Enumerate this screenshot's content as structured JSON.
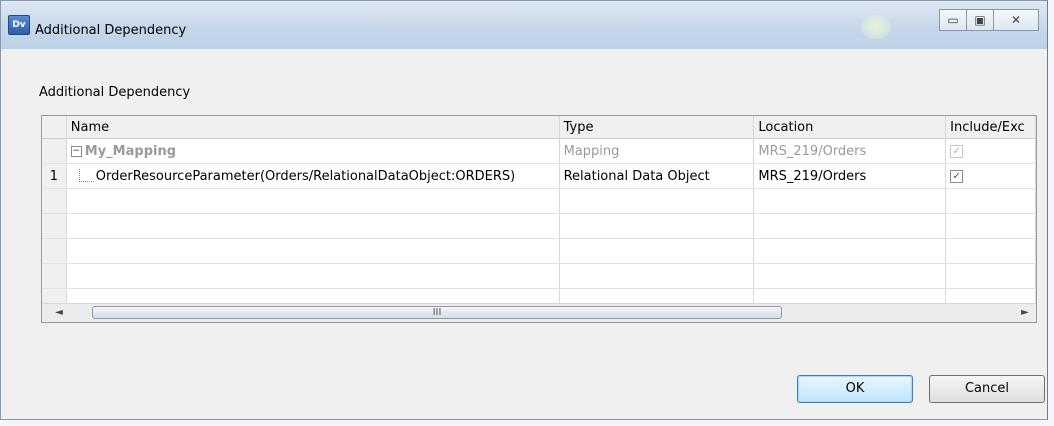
{
  "window": {
    "title": "Additional Dependency",
    "app_icon_text": "Dv",
    "controls": {
      "minimize": "▭",
      "maximize": "▣",
      "close": "✕"
    }
  },
  "section_label": "Additional Dependency",
  "grid": {
    "columns": [
      "Name",
      "Type",
      "Location",
      "Include/Exc"
    ],
    "rows": [
      {
        "num": "",
        "name": "My_Mapping",
        "type": "Mapping",
        "location": "MRS_219/Orders",
        "checked": true,
        "enabled": false,
        "kind": "parent"
      },
      {
        "num": "1",
        "name": "OrderResourceParameter(Orders/RelationalDataObject:ORDERS)",
        "type": "Relational Data Object",
        "location": "MRS_219/Orders",
        "checked": true,
        "enabled": true,
        "kind": "child"
      }
    ],
    "scroll": {
      "left_arrow": "◄",
      "right_arrow": "►",
      "grip": "III"
    }
  },
  "buttons": {
    "ok": "OK",
    "cancel": "Cancel"
  }
}
